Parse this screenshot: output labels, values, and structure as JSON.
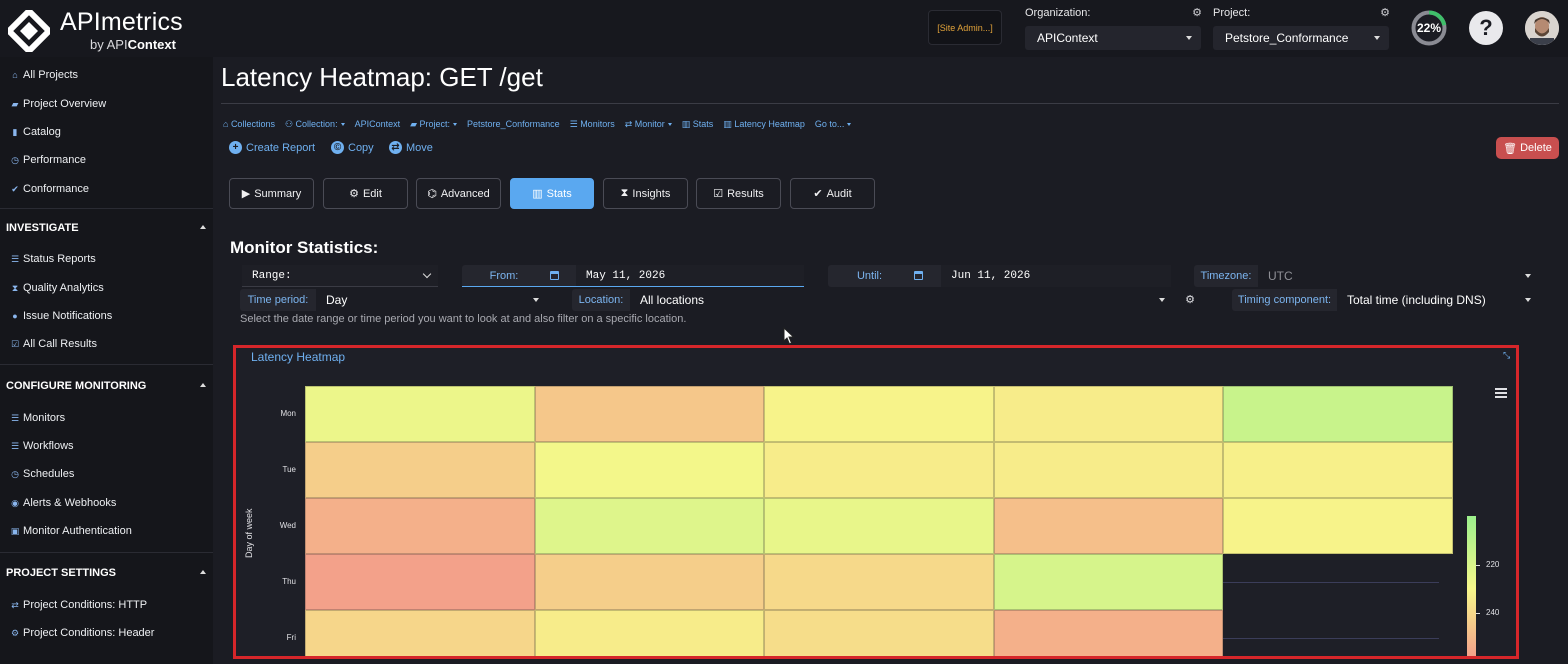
{
  "brand": {
    "name": "APImetrics",
    "sub_prefix": "by API",
    "sub_bold": "Context"
  },
  "header": {
    "site_admin": "[Site Admin...]",
    "org_label": "Organization:",
    "org_value": "APIContext",
    "project_label": "Project:",
    "project_value": "Petstore_Conformance",
    "progress_text": "22%",
    "progress_value": 0.22,
    "help": "?"
  },
  "sidebar": {
    "top_items": [
      {
        "label": "All Projects",
        "icon": "home-icon"
      },
      {
        "label": "Project Overview",
        "icon": "folder-icon"
      },
      {
        "label": "Catalog",
        "icon": "book-icon"
      },
      {
        "label": "Performance",
        "icon": "clock-icon"
      },
      {
        "label": "Conformance",
        "icon": "check-icon"
      }
    ],
    "investigate": {
      "title": "INVESTIGATE",
      "items": [
        {
          "label": "Status Reports",
          "icon": "list-icon"
        },
        {
          "label": "Quality Analytics",
          "icon": "hourglass-icon"
        },
        {
          "label": "Issue Notifications",
          "icon": "bell-icon"
        },
        {
          "label": "All Call Results",
          "icon": "check-square-icon"
        }
      ]
    },
    "configure": {
      "title": "CONFIGURE MONITORING",
      "items": [
        {
          "label": "Monitors",
          "icon": "list-icon"
        },
        {
          "label": "Workflows",
          "icon": "workflow-icon"
        },
        {
          "label": "Schedules",
          "icon": "clock-icon"
        },
        {
          "label": "Alerts & Webhooks",
          "icon": "globe-icon"
        },
        {
          "label": "Monitor Authentication",
          "icon": "lock-icon"
        }
      ]
    },
    "settings": {
      "title": "PROJECT SETTINGS",
      "items": [
        {
          "label": "Project Conditions: HTTP",
          "icon": "exchange-icon"
        },
        {
          "label": "Project Conditions: Header",
          "icon": "gear-icon"
        }
      ]
    }
  },
  "page": {
    "title": "Latency Heatmap: GET /get",
    "breadcrumb": [
      "Collections",
      "Collection:",
      "APIContext",
      "Project:",
      "Petstore_Conformance",
      "Monitors",
      "Monitor",
      "Stats",
      "Latency Heatmap",
      "Go to..."
    ],
    "actions": {
      "create_report": "Create Report",
      "copy": "Copy",
      "move": "Move",
      "delete": "Delete"
    },
    "tabs": [
      "Summary",
      "Edit",
      "Advanced",
      "Stats",
      "Insights",
      "Results",
      "Audit"
    ],
    "active_tab": "Stats"
  },
  "stats": {
    "title": "Monitor Statistics:",
    "range_label": "Range:",
    "from_label": "From:",
    "from_value": "May 11, 2026",
    "until_label": "Until:",
    "until_value": "Jun 11, 2026",
    "timezone_label": "Timezone:",
    "timezone_value": "UTC",
    "time_period_label": "Time period:",
    "time_period_value": "Day",
    "location_label": "Location:",
    "location_value": "All locations",
    "timing_label": "Timing component:",
    "timing_value": "Total time (including DNS)",
    "hint": "Select the date range or time period you want to look at and also filter on a specific location."
  },
  "heatmap": {
    "title": "Latency Heatmap",
    "ylabel": "Day of week",
    "legend_labels": [
      "220",
      "240"
    ]
  },
  "chart_data": {
    "type": "heatmap",
    "title": "Latency Heatmap",
    "ylabel": "Day of week",
    "rows": [
      "Mon",
      "Tue",
      "Wed",
      "Thu",
      "Fri"
    ],
    "columns": 5,
    "values": [
      [
        222,
        238,
        226,
        228,
        212
      ],
      [
        236,
        224,
        228,
        228,
        227
      ],
      [
        244,
        218,
        221,
        240,
        226
      ],
      [
        248,
        236,
        233,
        216,
        null
      ],
      [
        234,
        228,
        232,
        244,
        null
      ]
    ],
    "colorscale": [
      "#9cf08c",
      "#f7f78a",
      "#f39a8a"
    ],
    "color_range": [
      200,
      250
    ],
    "legend_ticks": [
      220,
      240
    ]
  }
}
